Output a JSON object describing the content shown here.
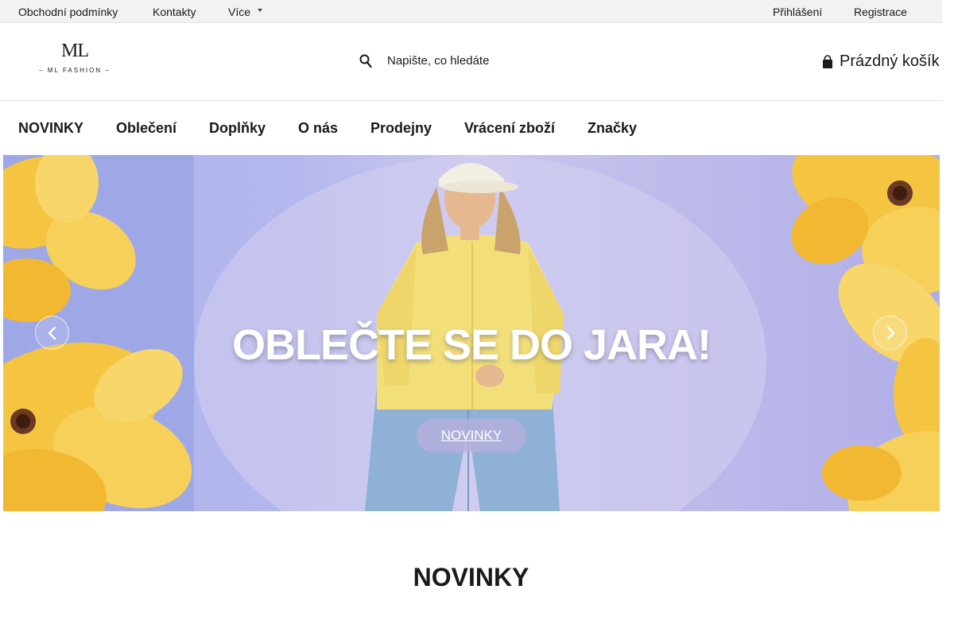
{
  "topbar": {
    "links": [
      "Obchodní podmínky",
      "Kontakty",
      "Více"
    ],
    "account": [
      "Přihlášení",
      "Registrace"
    ]
  },
  "header": {
    "logo": {
      "monogram": "ML",
      "brand": "– ML FASHION –"
    },
    "search_placeholder": "Napište, co hledáte",
    "cart_label": "Prázdný košík"
  },
  "nav": {
    "items": [
      "NOVINKY",
      "Oblečení",
      "Doplňky",
      "O nás",
      "Prodejny",
      "Vrácení zboží",
      "Značky"
    ]
  },
  "hero": {
    "headline": "OBLEČTE SE DO JARA!",
    "cta": "NOVINKY",
    "prev_icon": "chevron-left-icon",
    "next_icon": "chevron-right-icon"
  },
  "section": {
    "title": "NOVINKY"
  },
  "colors": {
    "topbar_bg": "#f2f2f2",
    "hero_bg": "#b4b7ed",
    "flower": "#f5c542",
    "shirt": "#f3df7a",
    "jeans": "#8fb1d6"
  }
}
